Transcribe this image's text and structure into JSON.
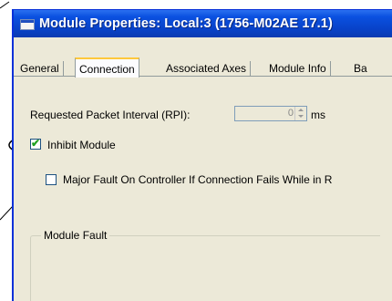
{
  "window": {
    "title": "Module Properties: Local:3 (1756-M02AE 17.1)"
  },
  "tabs": [
    {
      "label": "General",
      "active": false
    },
    {
      "label": "Connection",
      "active": true
    },
    {
      "label": "Associated Axes",
      "active": false
    },
    {
      "label": "Module Info",
      "active": false
    },
    {
      "label": "Ba",
      "active": false
    }
  ],
  "connection": {
    "rpi_label": "Requested Packet Interval (RPI):",
    "rpi_value": "0",
    "rpi_unit": "ms",
    "inhibit_label": "Inhibit Module",
    "inhibit_checked": true,
    "major_fault_label": "Major Fault On Controller If Connection Fails While in R",
    "major_fault_checked": false,
    "module_fault_label": "Module Fault"
  },
  "colors": {
    "titlebar": "#0a50e0",
    "dialog_bg": "#ece9d8",
    "active_tab_highlight": "#ffc83c",
    "check": "#21a121"
  }
}
